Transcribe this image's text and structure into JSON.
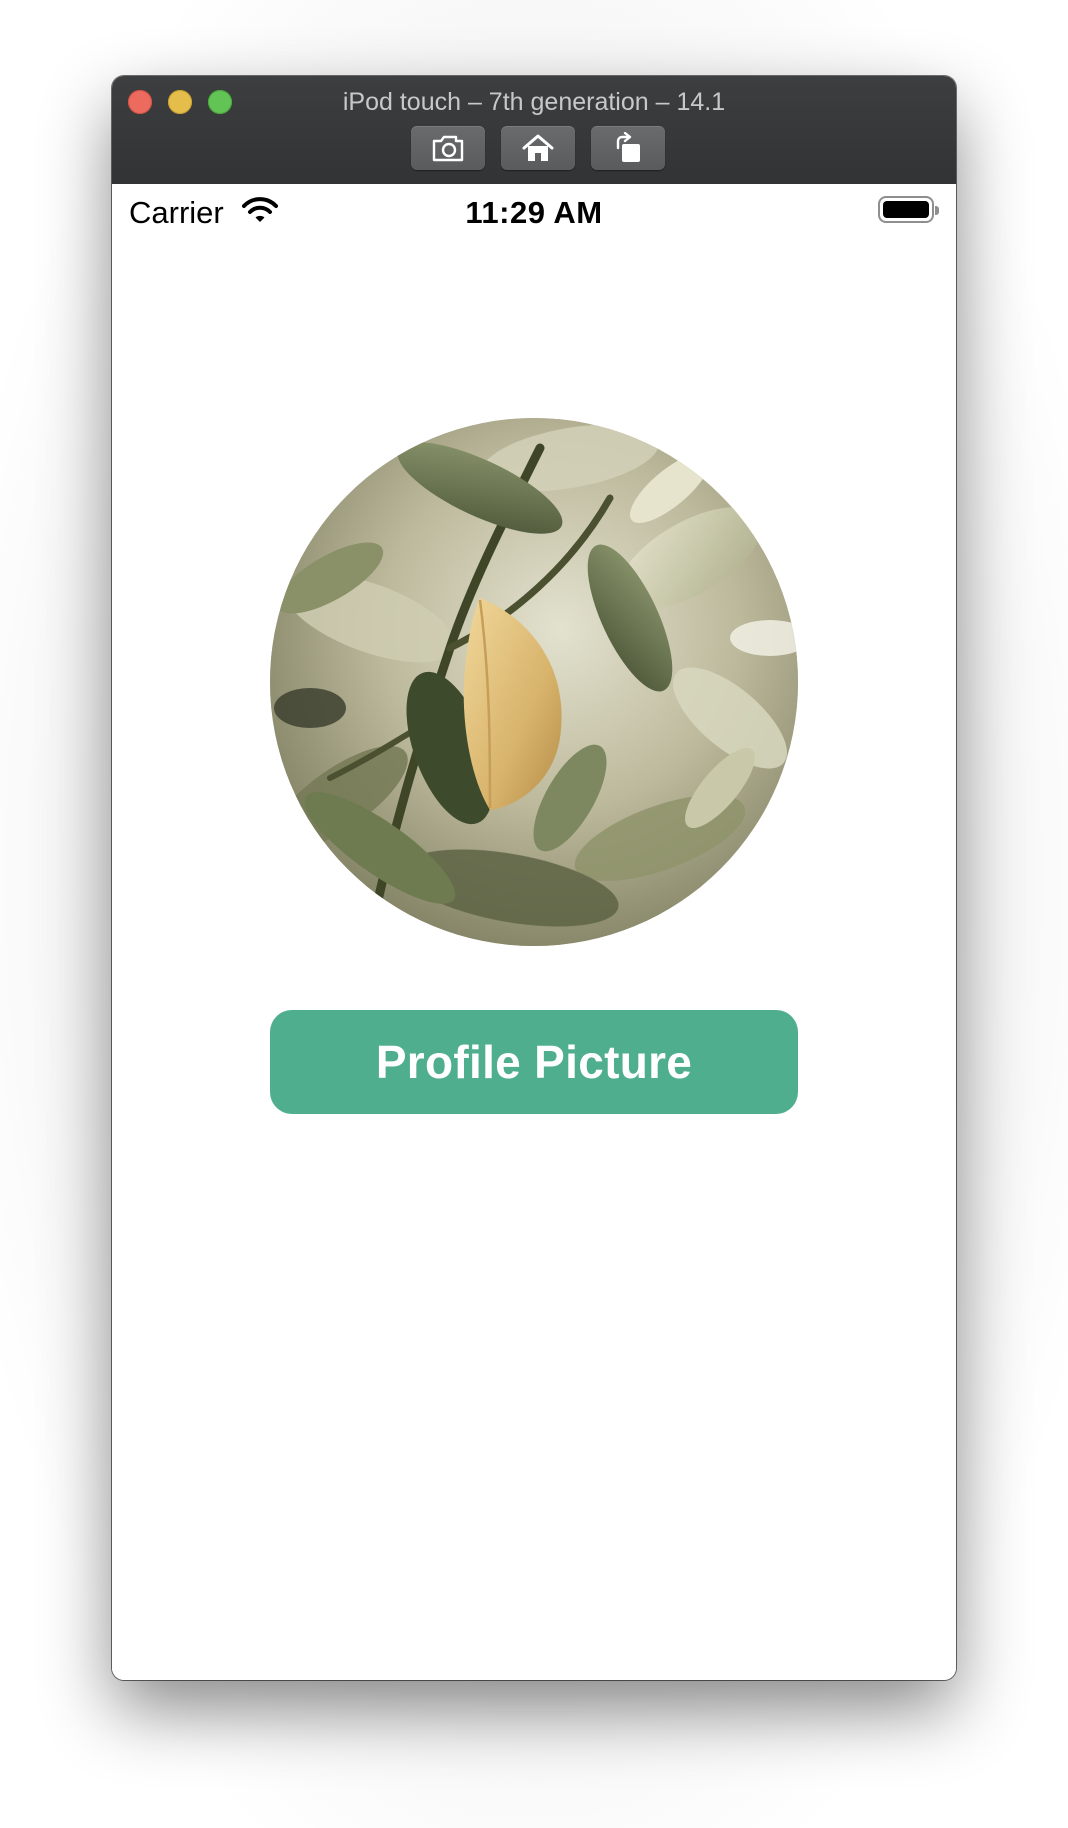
{
  "window": {
    "title": "iPod touch – 7th generation – 14.1",
    "toolbar": {
      "screenshot_icon": "camera-icon",
      "home_icon": "home-icon",
      "rotate_icon": "rotate-icon"
    }
  },
  "status_bar": {
    "carrier": "Carrier",
    "wifi_icon": "wifi-icon",
    "time": "11:29 AM",
    "battery_icon": "battery-icon",
    "battery_level": 1.0
  },
  "profile": {
    "image_subject": "circular photo of green and yellowed citrus leaves",
    "button_label": "Profile Picture"
  },
  "colors": {
    "titlebar": "#36373a",
    "button_accent": "#4fae8e",
    "screen_background": "#ffffff"
  }
}
